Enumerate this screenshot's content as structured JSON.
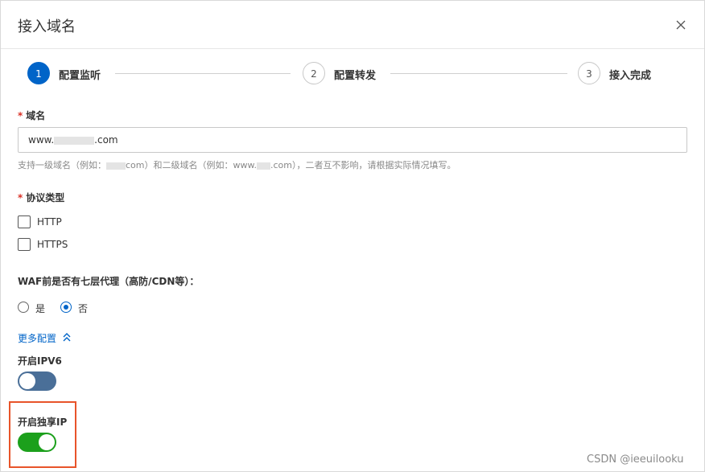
{
  "dialog": {
    "title": "接入域名",
    "close_icon": "close-icon"
  },
  "steps": [
    {
      "number": "1",
      "label": "配置监听",
      "state": "active"
    },
    {
      "number": "2",
      "label": "配置转发",
      "state": "todo"
    },
    {
      "number": "3",
      "label": "接入完成",
      "state": "todo"
    }
  ],
  "domain": {
    "required_mark": "*",
    "label": "域名",
    "value_prefix": "www.",
    "value_suffix": ".com",
    "hint_a": "支持一级域名（例如：",
    "hint_b": "com）和二级域名（例如：www.",
    "hint_c": ".com），二者互不影响，请根据实际情况填写。"
  },
  "protocol": {
    "required_mark": "*",
    "label": "协议类型",
    "options": [
      {
        "label": "HTTP",
        "checked": false
      },
      {
        "label": "HTTPS",
        "checked": false
      }
    ]
  },
  "proxy": {
    "label": "WAF前是否有七层代理（高防/CDN等）：",
    "options": [
      {
        "label": "是",
        "selected": false
      },
      {
        "label": "否",
        "selected": true
      }
    ]
  },
  "more_config": {
    "label": "更多配置",
    "icon": "double-chevron-up-icon"
  },
  "ipv6": {
    "label": "开启IPV6",
    "enabled": false
  },
  "exclusive_ip": {
    "label": "开启独享IP",
    "enabled": true
  },
  "watermark": "CSDN @ieeuilooku",
  "colors": {
    "primary": "#0064c8",
    "toggle_off": "#4a6f98",
    "toggle_on": "#1ca01c",
    "required": "#d93026",
    "highlight": "#e8542a"
  }
}
